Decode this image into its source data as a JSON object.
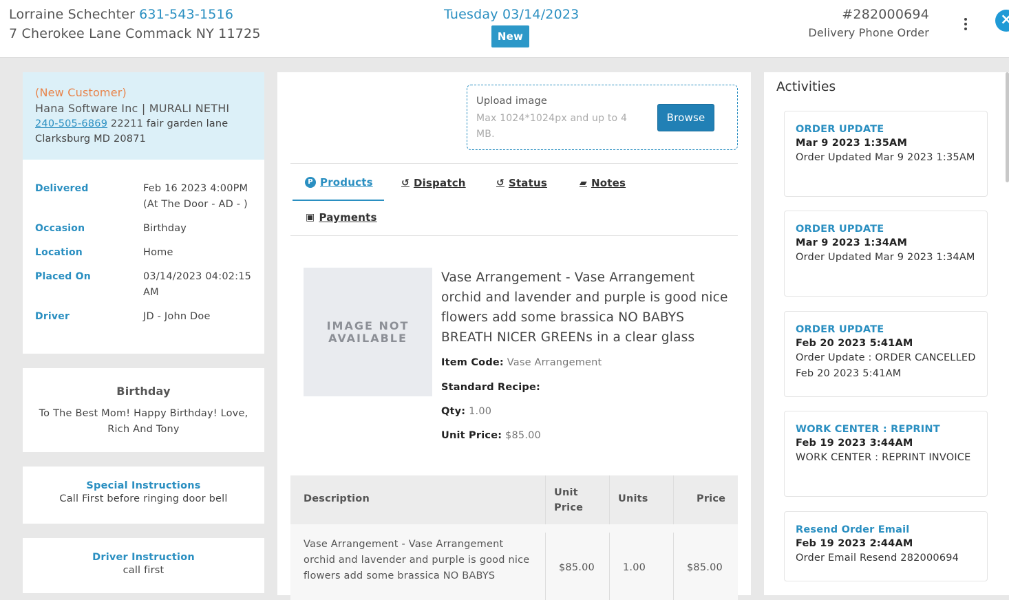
{
  "header": {
    "customer_name": "Lorraine Schechter",
    "customer_phone": "631-543-1516",
    "customer_address": "7 Cherokee Lane Commack NY 11725",
    "order_date": "Tuesday 03/14/2023",
    "status": "New",
    "order_number": "#282000694",
    "order_type": "Delivery Phone Order"
  },
  "customer_card": {
    "new_customer_label": "(New Customer)",
    "company": "Hana Software Inc | MURALI NETHI",
    "phone": "240-505-6869",
    "address_line": " 22211 fair garden lane",
    "city_line": "Clarksburg MD 20871"
  },
  "details": [
    {
      "label": "Delivered",
      "value": "Feb 16 2023 4:00PM (At The Door - AD - )"
    },
    {
      "label": "Occasion",
      "value": "Birthday"
    },
    {
      "label": "Location",
      "value": "Home"
    },
    {
      "label": "Placed On",
      "value": "03/14/2023 04:02:15 AM"
    },
    {
      "label": "Driver",
      "value": "JD - John Doe"
    }
  ],
  "card_message": {
    "title": "Birthday",
    "body": "To The Best Mom! Happy Birthday! Love, Rich And Tony"
  },
  "special_instructions": {
    "title": "Special Instructions",
    "body": "Call First before ringing door bell"
  },
  "driver_instruction": {
    "title": "Driver Instruction",
    "body": "call first"
  },
  "upload": {
    "label": "Upload image",
    "hint": "Max 1024*1024px and up to 4 MB.",
    "browse_label": "Browse"
  },
  "tabs": {
    "products": "Products",
    "dispatch": "Dispatch",
    "status": "Status",
    "notes": "Notes",
    "payments": "Payments"
  },
  "product": {
    "image_placeholder_line1": "IMAGE NOT",
    "image_placeholder_line2": "AVAILABLE",
    "name": "Vase Arrangement - Vase Arrangement orchid and lavender and purple is good nice flowers add some brassica NO BABYS BREATH NICER GREENs in a clear glass",
    "item_code_label": "Item Code:",
    "item_code": "Vase Arrangement",
    "recipe_label": "Standard Recipe:",
    "qty_label": "Qty:",
    "qty": "1.00",
    "unit_price_label": "Unit Price:",
    "unit_price": "$85.00"
  },
  "line_items": {
    "headers": {
      "description": "Description",
      "unit_price_1": "Unit",
      "unit_price_2": "Price",
      "units": "Units",
      "price": "Price"
    },
    "rows": [
      {
        "description": "Vase Arrangement - Vase Arrangement orchid and lavender and purple is good nice flowers add some brassica NO BABYS",
        "unit_price": "$85.00",
        "units": "1.00",
        "price": "$85.00"
      }
    ]
  },
  "activities": {
    "title": "Activities",
    "items": [
      {
        "type": "ORDER UPDATE",
        "time": "Mar 9 2023 1:35AM",
        "desc": "Order Updated Mar 9 2023 1:35AM"
      },
      {
        "type": "ORDER UPDATE",
        "time": "Mar 9 2023 1:34AM",
        "desc": "Order Updated Mar 9 2023 1:34AM"
      },
      {
        "type": "ORDER UPDATE",
        "time": "Feb 20 2023 5:41AM",
        "desc": "Order Update : ORDER CANCELLED Feb 20 2023 5:41AM"
      },
      {
        "type": "WORK CENTER : REPRINT",
        "time": "Feb 19 2023 3:44AM",
        "desc": "WORK CENTER : REPRINT INVOICE"
      },
      {
        "type": "Resend Order Email",
        "time": "Feb 19 2023 2:44AM",
        "desc": "Order Email Resend 282000694"
      }
    ]
  },
  "colors": {
    "accent": "#2a8fc1",
    "new_customer": "#e8834a",
    "badge": "#2c98c8"
  }
}
